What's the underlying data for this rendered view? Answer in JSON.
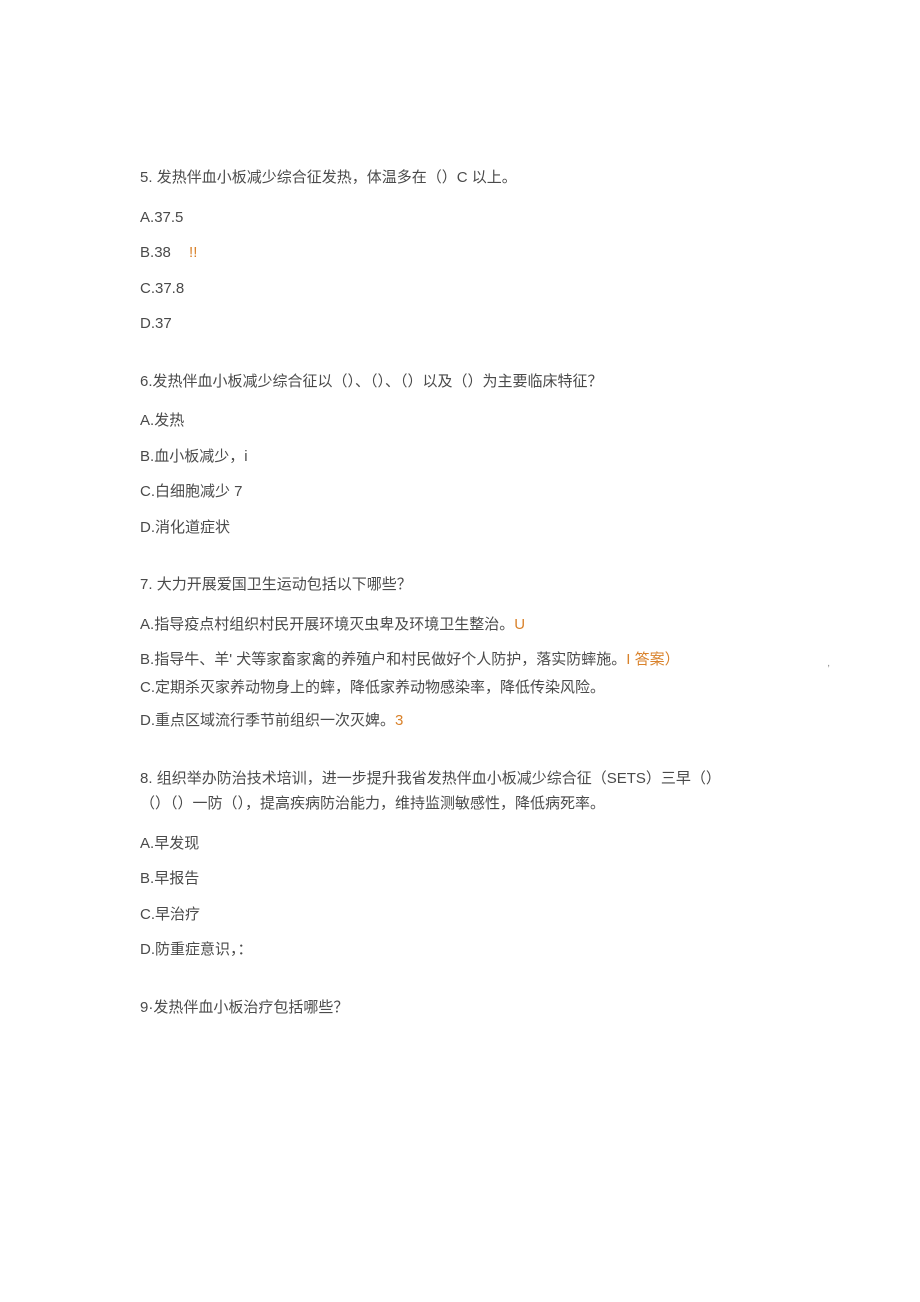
{
  "q5": {
    "number": "5.",
    "text": "发热伴血小板减少综合征发热，体温多在（）C 以上。",
    "options": {
      "a": {
        "prefix": "A.",
        "text": "37.5"
      },
      "b": {
        "prefix": "B.",
        "text": "38",
        "mark": "!!"
      },
      "c": {
        "prefix": "C.",
        "text": "37.8"
      },
      "d": {
        "prefix": "D.",
        "text": "37"
      }
    }
  },
  "q6": {
    "number": "6.",
    "text": "发热伴血小板减少综合征以（）、（）、（）以及（）为主要临床特征？",
    "options": {
      "a": {
        "prefix": "A.",
        "text": "发热"
      },
      "b": {
        "prefix": "B.",
        "text": "血小板减少，i"
      },
      "c": {
        "prefix": "C.",
        "text": "白细胞减少 7"
      },
      "d": {
        "prefix": "D.",
        "text": "消化道症状"
      }
    }
  },
  "q7": {
    "number": "7.",
    "text": "大力开展爱国卫生运动包括以下哪些？",
    "options": {
      "a": {
        "prefix": "A.",
        "text": "指导疫点村组织村民开展环境灭虫卑及环境卫生整治。",
        "mark": "U"
      },
      "b": {
        "prefix": "B.",
        "text": "指导牛、羊' 犬等家畜家禽的养殖户和村民做好个人防护，落实防蟀施。",
        "mark": "I 答案）"
      },
      "c": {
        "prefix": "C.",
        "text": "定期杀灭家养动物身上的蟀，降低家养动物感染率，降低传染风险。"
      },
      "d": {
        "prefix": "D.",
        "text": "重点区域流行季节前组织一次灭婢。",
        "mark": "3"
      }
    }
  },
  "q8": {
    "number": "8.",
    "text_line1": "组织举办防治技术培训，进一步提升我省发热伴血小板减少综合征（SETS）三早（）",
    "text_line2": "（）（）一防（），提高疾病防治能力，维持监测敏感性，降低病死率。",
    "options": {
      "a": {
        "prefix": "A.",
        "text": "早发现"
      },
      "b": {
        "prefix": "B.",
        "text": "早报告"
      },
      "c": {
        "prefix": "C.",
        "text": "早治疗"
      },
      "d": {
        "prefix": "D.",
        "text": "防重症意识，："
      }
    }
  },
  "q9": {
    "number": "9·",
    "text": "发热伴血小板治疗包括哪些？"
  }
}
